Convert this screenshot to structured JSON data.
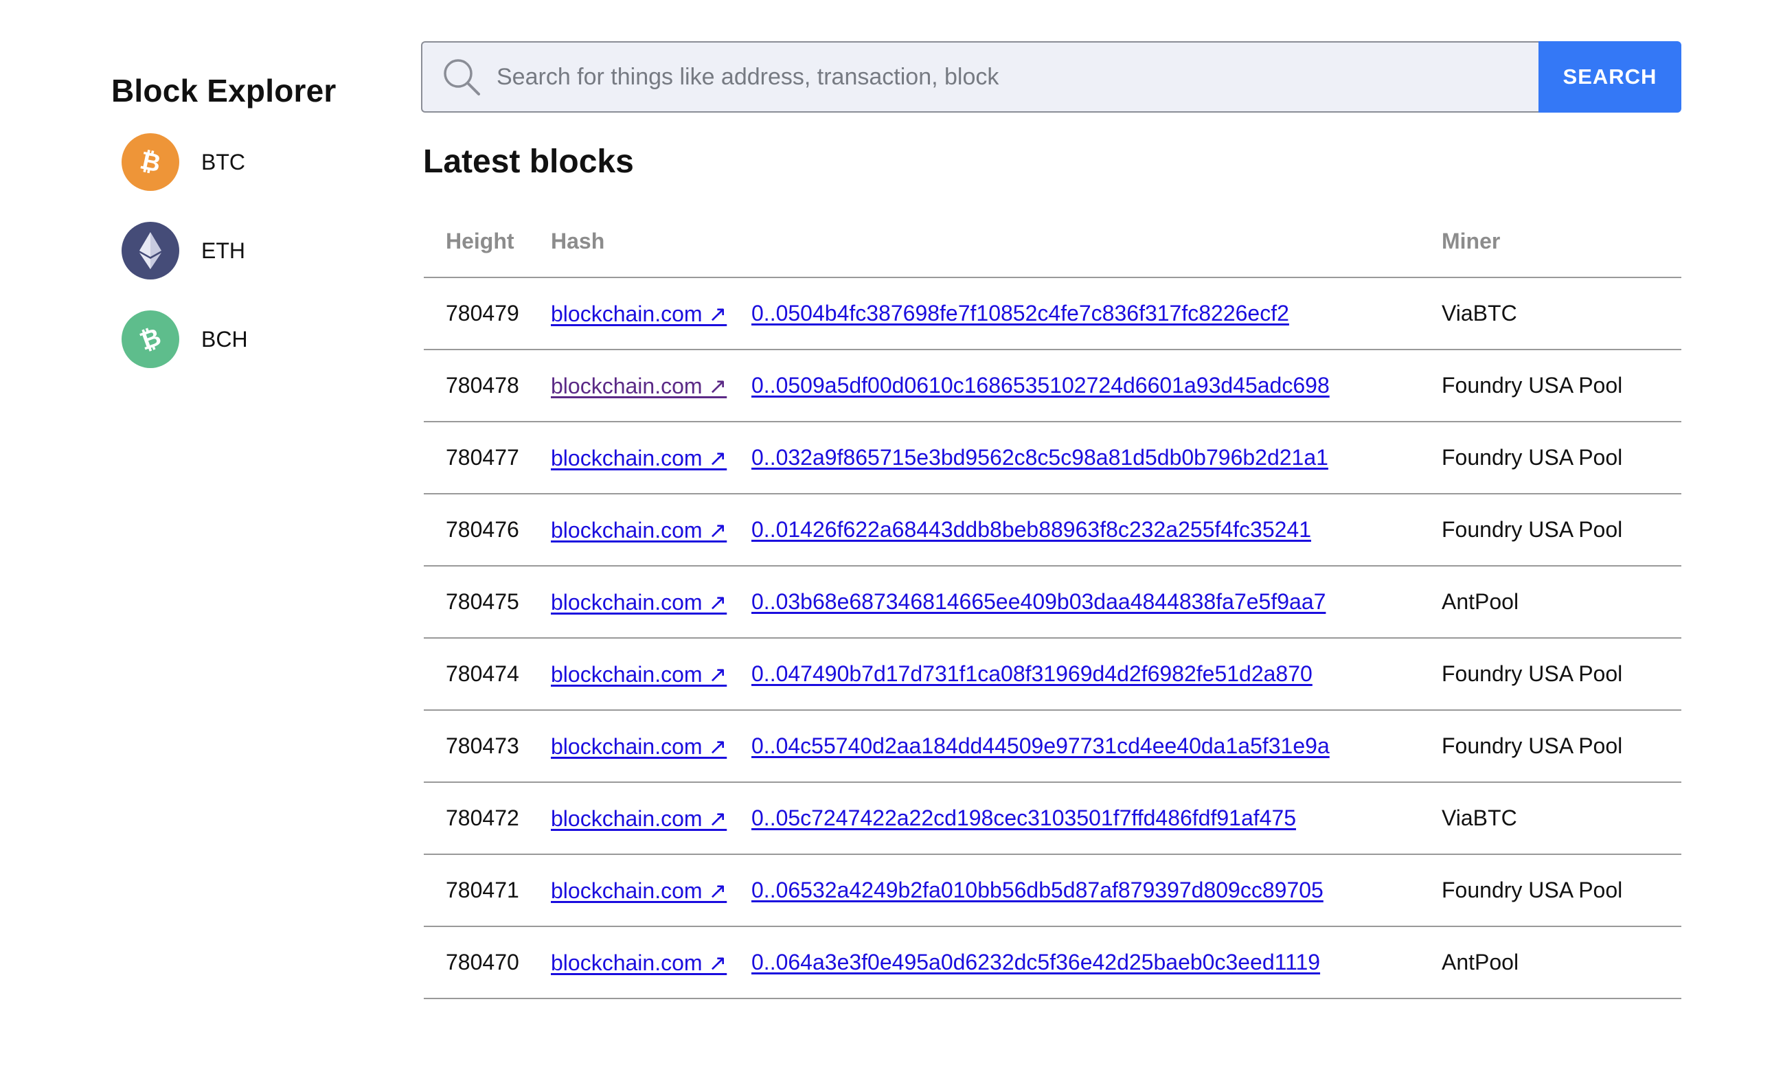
{
  "app": {
    "title": "Block Explorer"
  },
  "sidebar": {
    "coins": [
      {
        "label": "BTC",
        "icon": "bitcoin-icon",
        "color": "#ee9538"
      },
      {
        "label": "ETH",
        "icon": "ethereum-icon",
        "color": "#454c78"
      },
      {
        "label": "BCH",
        "icon": "bitcoin-cash-icon",
        "color": "#5ebd8c"
      }
    ]
  },
  "search": {
    "placeholder": "Search for things like address, transaction, block",
    "value": "",
    "button_label": "SEARCH",
    "button_color": "#3478f6"
  },
  "main": {
    "title": "Latest blocks",
    "columns": [
      "Height",
      "Hash",
      "Miner"
    ],
    "rows": [
      {
        "height": "780479",
        "link": "blockchain.com ↗",
        "hash": "0..0504b4fc387698fe7f10852c4fe7c836f317fc8226ecf2",
        "miner": "ViaBTC"
      },
      {
        "height": "780478",
        "link": "blockchain.com ↗",
        "hash": "0..0509a5df00d0610c1686535102724d6601a93d45adc698",
        "miner": "Foundry USA Pool"
      },
      {
        "height": "780477",
        "link": "blockchain.com ↗",
        "hash": "0..032a9f865715e3bd9562c8c5c98a81d5db0b796b2d21a1",
        "miner": "Foundry USA Pool"
      },
      {
        "height": "780476",
        "link": "blockchain.com ↗",
        "hash": "0..01426f622a68443ddb8beb88963f8c232a255f4fc35241",
        "miner": "Foundry USA Pool"
      },
      {
        "height": "780475",
        "link": "blockchain.com ↗",
        "hash": "0..03b68e687346814665ee409b03daa4844838fa7e5f9aa7",
        "miner": "AntPool"
      },
      {
        "height": "780474",
        "link": "blockchain.com ↗",
        "hash": "0..047490b7d17d731f1ca08f31969d4d2f6982fe51d2a870",
        "miner": "Foundry USA Pool"
      },
      {
        "height": "780473",
        "link": "blockchain.com ↗",
        "hash": "0..04c55740d2aa184dd44509e97731cd4ee40da1a5f31e9a",
        "miner": "Foundry USA Pool"
      },
      {
        "height": "780472",
        "link": "blockchain.com ↗",
        "hash": "0..05c7247422a22cd198cec3103501f7ffd486fdf91af475",
        "miner": "ViaBTC"
      },
      {
        "height": "780471",
        "link": "blockchain.com ↗",
        "hash": "0..06532a4249b2fa010bb56db5d87af879397d809cc89705",
        "miner": "Foundry USA Pool"
      },
      {
        "height": "780470",
        "link": "blockchain.com ↗",
        "hash": "0..064a3e3f0e495a0d6232dc5f36e42d25baeb0c3eed1119",
        "miner": "AntPool"
      }
    ]
  }
}
